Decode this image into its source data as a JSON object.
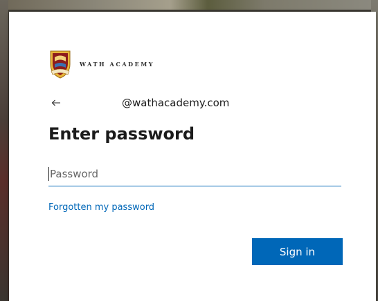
{
  "brand": {
    "name": "WATH ACADEMY",
    "crest_icon": "school-crest-icon"
  },
  "identity": {
    "back_icon": "back-arrow-icon",
    "email": "@wathacademy.com"
  },
  "title": "Enter password",
  "password": {
    "value": "",
    "placeholder": "Password"
  },
  "links": {
    "forgot": "Forgotten my password"
  },
  "actions": {
    "sign_in": "Sign in"
  },
  "colors": {
    "accent": "#0067b8",
    "text": "#1b1b1b",
    "card": "#ffffff"
  }
}
